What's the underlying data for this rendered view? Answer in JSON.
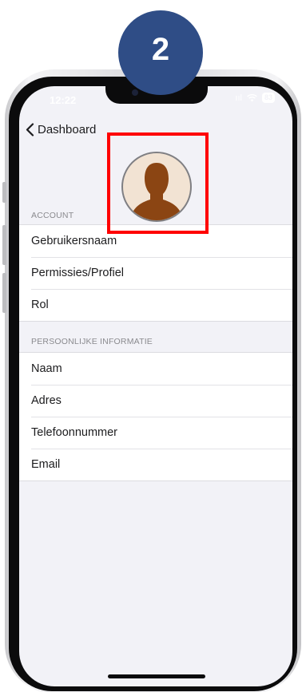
{
  "step_badge": {
    "number": "2"
  },
  "status_bar": {
    "time": "12:22",
    "signal": "ııl",
    "wifi": "wifi-icon",
    "battery": "83"
  },
  "nav": {
    "back_label": "Dashboard"
  },
  "account": {
    "header": "ACCOUNT",
    "items": [
      "Gebruikersnaam",
      "Permissies/Profiel",
      "Rol"
    ]
  },
  "personal": {
    "header": "PERSOONLIJKE INFORMATIE",
    "items": [
      "Naam",
      "Adres",
      "Telefoonnummer",
      "Email"
    ]
  },
  "colors": {
    "badge": "#2f4d86",
    "highlight": "#ff0000",
    "avatar_skin": "#8b4513",
    "screen_bg": "#f2f2f7"
  }
}
